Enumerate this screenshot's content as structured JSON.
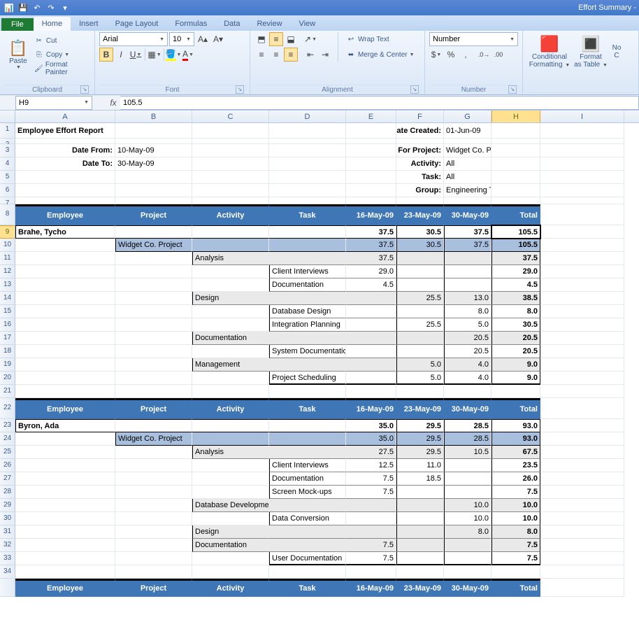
{
  "app": {
    "doc_title": "Effort Summary  -"
  },
  "qa": {
    "save": "💾",
    "undo": "↶",
    "redo": "↷"
  },
  "tabs": {
    "file": "File",
    "home": "Home",
    "insert": "Insert",
    "page": "Page Layout",
    "formulas": "Formulas",
    "data": "Data",
    "review": "Review",
    "view": "View"
  },
  "ribbon": {
    "clipboard": {
      "paste": "Paste",
      "cut": "Cut",
      "copy": "Copy",
      "painter": "Format Painter",
      "label": "Clipboard"
    },
    "font": {
      "name": "Arial",
      "size": "10",
      "label": "Font",
      "bold": "B",
      "italic": "I",
      "underline": "U"
    },
    "alignment": {
      "label": "Alignment",
      "wrap": "Wrap Text",
      "merge": "Merge & Center"
    },
    "number": {
      "label": "Number",
      "format": "Number"
    },
    "styles": {
      "conditional": "Conditional",
      "formatting": "Formatting",
      "format": "Format",
      "astable": "as Table",
      "cell_lbl": "C"
    }
  },
  "formula_bar": {
    "name": "H9",
    "value": "105.5"
  },
  "cols": [
    "A",
    "B",
    "C",
    "D",
    "E",
    "F",
    "G",
    "H",
    "I"
  ],
  "report": {
    "title": "Employee Effort Report",
    "date_from_lbl": "Date From:",
    "date_from": "10-May-09",
    "date_to_lbl": "Date To:",
    "date_to": "30-May-09",
    "created_lbl": "Date Created:",
    "created": "01-Jun-09",
    "project_lbl": "For Project:",
    "project": "Widget Co. Project",
    "activity_lbl": "Activity:",
    "activity": "All",
    "task_lbl": "Task:",
    "task": "All",
    "group_lbl": "Group:",
    "group": "Engineering Team"
  },
  "hdr": {
    "emp": "Employee",
    "proj": "Project",
    "act": "Activity",
    "task": "Task",
    "d1": "16-May-09",
    "d2": "23-May-09",
    "d3": "30-May-09",
    "tot": "Total"
  },
  "emp1": {
    "name": "Brahe, Tycho",
    "d1": "37.5",
    "d2": "30.5",
    "d3": "37.5",
    "tot": "105.5",
    "proj": "Widget Co. Project",
    "pd1": "37.5",
    "pd2": "30.5",
    "pd3": "37.5",
    "ptot": "105.5",
    "a1": "Analysis",
    "a1d1": "37.5",
    "a1tot": "37.5",
    "t11": "Client Interviews",
    "t11d1": "29.0",
    "t11tot": "29.0",
    "t12": "Documentation",
    "t12d1": "4.5",
    "t12tot": "4.5",
    "a2": "Design",
    "a2d2": "25.5",
    "a2d3": "13.0",
    "a2tot": "38.5",
    "t21": "Database Design",
    "t21d3": "8.0",
    "t21tot": "8.0",
    "t22": "Integration Planning",
    "t22d2": "25.5",
    "t22d3": "5.0",
    "t22tot": "30.5",
    "a3": "Documentation",
    "a3d3": "20.5",
    "a3tot": "20.5",
    "t31": "System Documentation",
    "t31d3": "20.5",
    "t31tot": "20.5",
    "a4": "Management",
    "a4d2": "5.0",
    "a4d3": "4.0",
    "a4tot": "9.0",
    "t41": "Project Scheduling",
    "t41d2": "5.0",
    "t41d3": "4.0",
    "t41tot": "9.0"
  },
  "emp2": {
    "name": "Byron, Ada",
    "d1": "35.0",
    "d2": "29.5",
    "d3": "28.5",
    "tot": "93.0",
    "proj": "Widget Co. Project",
    "pd1": "35.0",
    "pd2": "29.5",
    "pd3": "28.5",
    "ptot": "93.0",
    "a1": "Analysis",
    "a1d1": "27.5",
    "a1d2": "29.5",
    "a1d3": "10.5",
    "a1tot": "67.5",
    "t11": "Client Interviews",
    "t11d1": "12.5",
    "t11d2": "11.0",
    "t11tot": "23.5",
    "t12": "Documentation",
    "t12d1": "7.5",
    "t12d2": "18.5",
    "t12tot": "26.0",
    "t13": "Screen Mock-ups",
    "t13d1": "7.5",
    "t13tot": "7.5",
    "a2": "Database Development",
    "a2d3": "10.0",
    "a2tot": "10.0",
    "t21": "Data Conversion",
    "t21d3": "10.0",
    "t21tot": "10.0",
    "a3": "Design",
    "a3d3": "8.0",
    "a3tot": "8.0",
    "a4": "Documentation",
    "a4d1": "7.5",
    "a4tot": "7.5",
    "t41": "User Documentation",
    "t41d1": "7.5",
    "t41tot": "7.5"
  }
}
